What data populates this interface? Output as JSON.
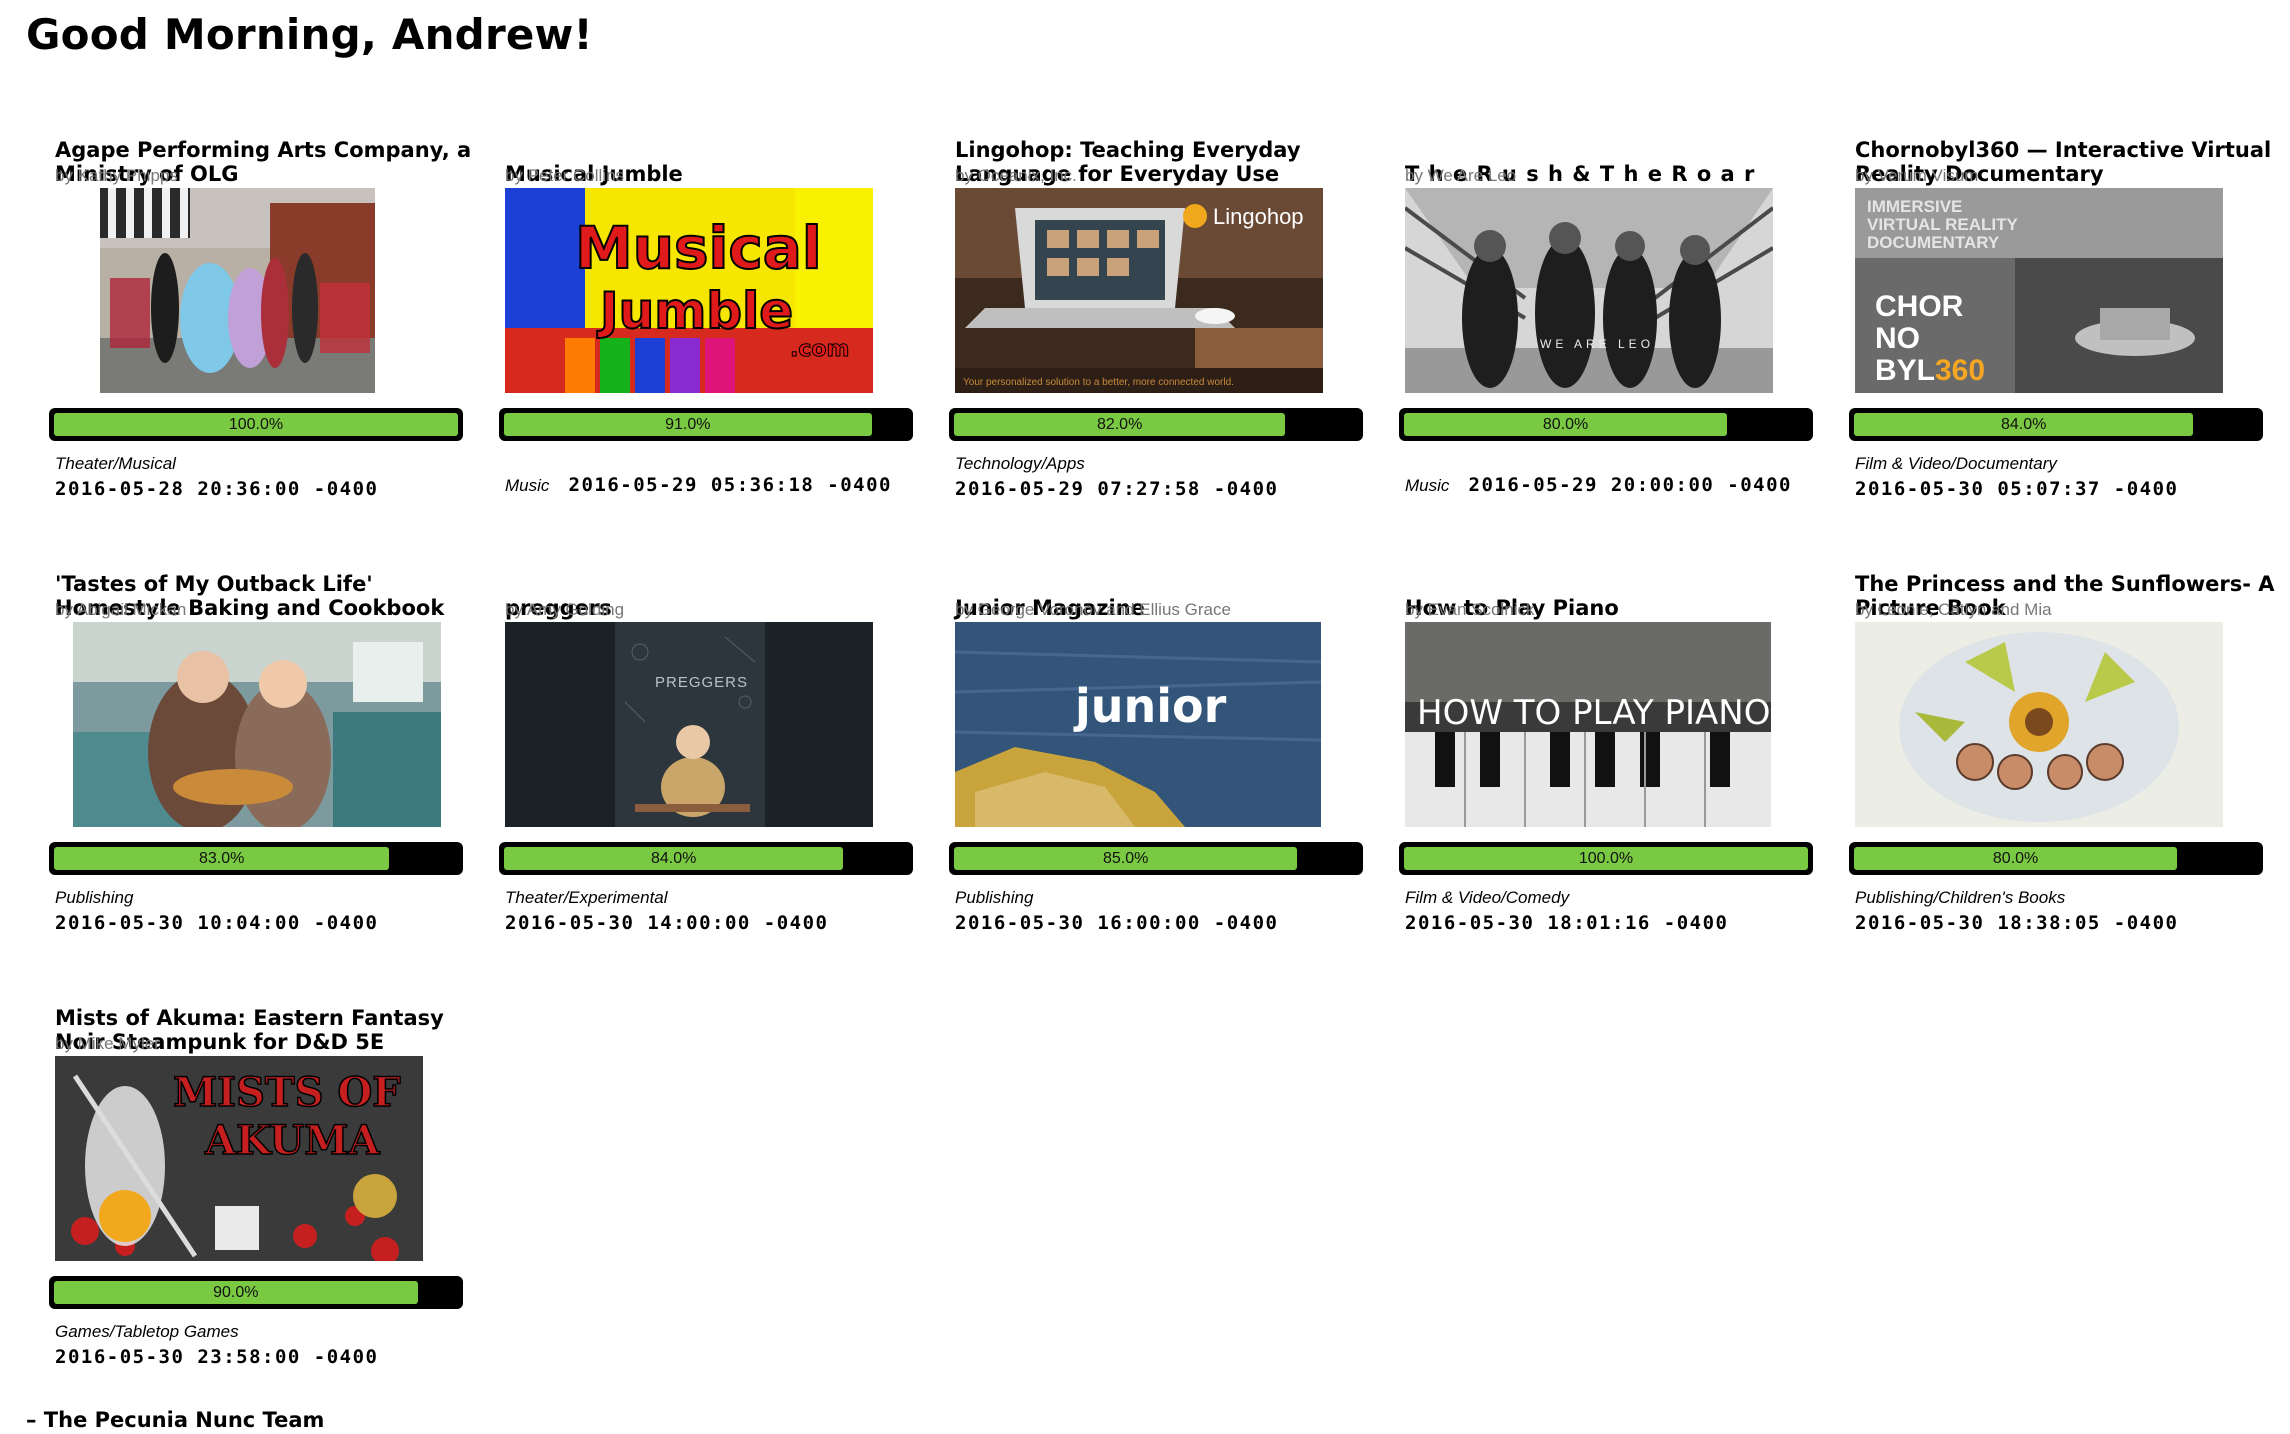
{
  "greeting": "Good Morning, Andrew!",
  "signoff": "– The Pecunia Nunc Team",
  "accent_color": "#7ac943",
  "projects": [
    {
      "title": "Agape Performing Arts Company, a Ministry of OLG",
      "by": "by Kathy Phipps",
      "progress_label": "100.0%",
      "progress": 1.0,
      "category": "Theater/Musical",
      "date": "2016-05-28 20:36:00 -0400",
      "image": "costumed-performers-photo"
    },
    {
      "title": "Musical Jumble",
      "by": "by Peter Collins",
      "progress_label": "91.0%",
      "progress": 0.91,
      "category": "Music",
      "date": "2016-05-29 05:36:18 -0400",
      "image": "musical-jumble-logo",
      "image_text": "MusicalJumble.com"
    },
    {
      "title": "Lingohop: Teaching Everyday Language for Everyday Use",
      "by": "by Oceanix, Inc.",
      "progress_label": "82.0%",
      "progress": 0.82,
      "category": "Technology/Apps",
      "date": "2016-05-29 07:27:58 -0400",
      "image": "laptop-cafe-photo",
      "image_text": "Lingohop",
      "image_caption": "Your personalized solution to a better, more connected world."
    },
    {
      "title": "T h e R u s h & T h e R o a r",
      "by": "by We Are Leo",
      "progress_label": "80.0%",
      "progress": 0.8,
      "category": "Music",
      "date": "2016-05-29 20:00:00 -0400",
      "image": "band-on-bridge-photo",
      "image_text": "WE ARE LEO"
    },
    {
      "title": "Chornobyl360 — Interactive Virtual Reality Documentary",
      "by": "by Verum Visum",
      "progress_label": "84.0%",
      "progress": 0.84,
      "category": "Film & Video/Documentary",
      "date": "2016-05-30 05:07:37 -0400",
      "image": "chornobyl-aerial-photo",
      "image_text": "IMMERSIVE VIRTUAL REALITY DOCUMENTARY",
      "image_logo": "CHOR NO BYL360"
    },
    {
      "title": "'Tastes of My Outback Life' Homestyle Baking and Cookbook",
      "by": "by Abigail Mickan",
      "progress_label": "83.0%",
      "progress": 0.83,
      "category": "Publishing",
      "date": "2016-05-30 10:04:00 -0400",
      "image": "kitchen-bakers-photo"
    },
    {
      "title": "preggers",
      "by": "by Amy Golding",
      "progress_label": "84.0%",
      "progress": 0.84,
      "category": "Theater/Experimental",
      "date": "2016-05-30 14:00:00 -0400",
      "image": "preggers-poster",
      "image_text": "PREGGERS"
    },
    {
      "title": "Junior Magazine",
      "by": "by George Voronov and Ellius Grace",
      "progress_label": "85.0%",
      "progress": 0.85,
      "category": "Publishing",
      "date": "2016-05-30 16:00:00 -0400",
      "image": "sea-rock-photo",
      "image_text": "junior"
    },
    {
      "title": "How to Play Piano",
      "by": "by Evan Scolnick",
      "progress_label": "100.0%",
      "progress": 1.0,
      "category": "Film & Video/Comedy",
      "date": "2016-05-30 18:01:16 -0400",
      "image": "piano-keys-photo",
      "image_text": "HOW TO PLAY PIANO"
    },
    {
      "title": "The Princess and the Sunflowers- A Picture Book",
      "by": "by Leonie, Catlyn and Mia",
      "progress_label": "80.0%",
      "progress": 0.8,
      "category": "Publishing/Children's Books",
      "date": "2016-05-30 18:38:05 -0400",
      "image": "sunflower-illustration"
    },
    {
      "title": "Mists of Akuma: Eastern Fantasy Noir Steampunk for D&D 5E",
      "by": "by Mike Myler",
      "progress_label": "90.0%",
      "progress": 0.9,
      "category": "Games/Tabletop Games",
      "date": "2016-05-30 23:58:00 -0400",
      "image": "mists-of-akuma-art",
      "image_text": "MISTS OF AKUMA"
    }
  ]
}
